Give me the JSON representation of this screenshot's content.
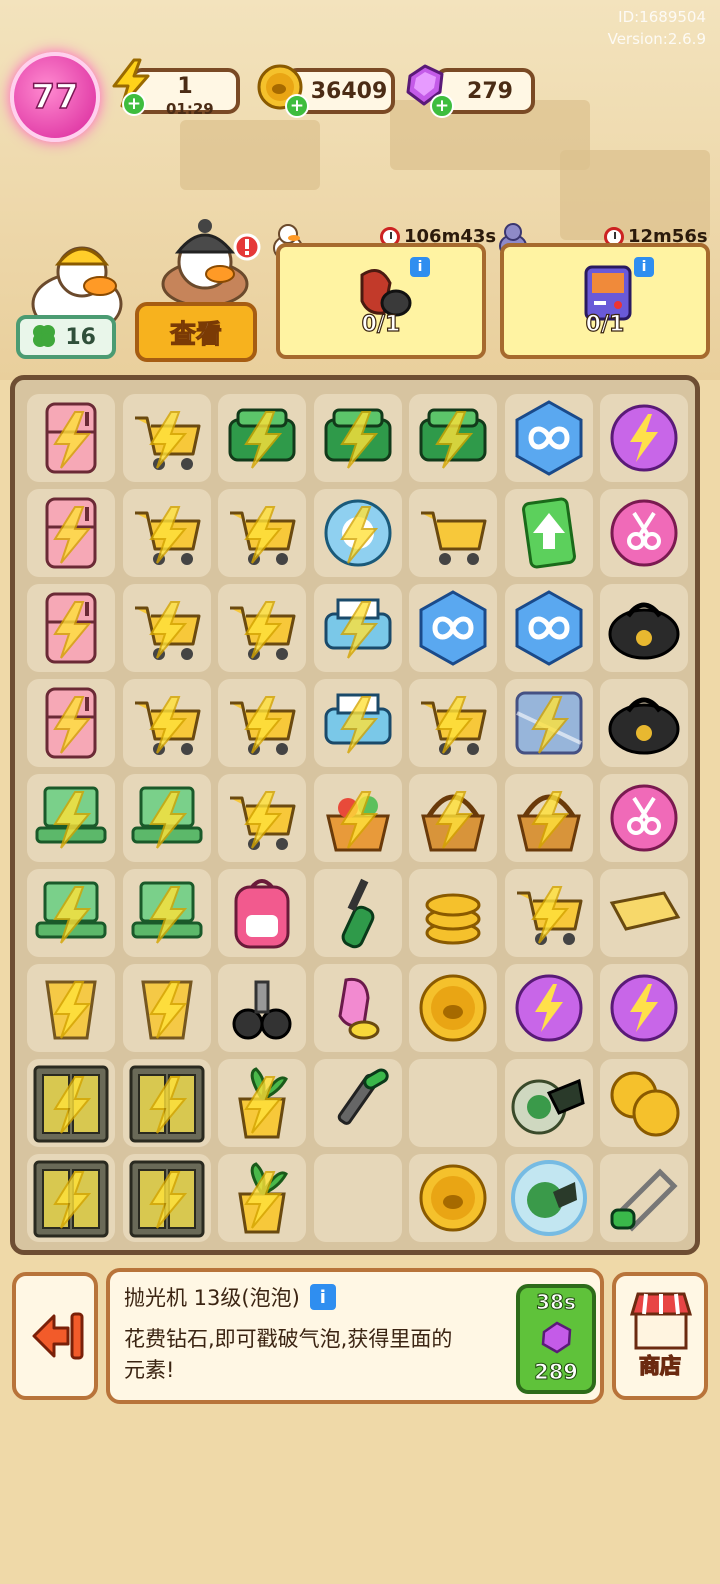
{
  "meta": {
    "id_text": "ID:1689504",
    "version_text": "Version:2.6.9"
  },
  "status": {
    "level": "77",
    "energy": "1",
    "energy_timer": "01:29",
    "coins": "36409",
    "gems": "279"
  },
  "characters": {
    "clover_count": "16",
    "view_button": "查看"
  },
  "orders": [
    {
      "timer": "106m43s",
      "progress": "0/1",
      "item": "chainsaw-icon"
    },
    {
      "timer": "12m56s",
      "progress": "0/1",
      "item": "handheld-console-icon"
    }
  ],
  "board": {
    "cols": 7,
    "rows": 9,
    "cells": [
      [
        "fridge-icon",
        "cart-icon",
        "sewing-machine-icon",
        "sewing-machine-icon",
        "sewing-machine-icon",
        "infinity-hex-icon",
        "lightning-orb-icon"
      ],
      [
        "fridge-icon",
        "cart-icon",
        "cart-icon",
        "robot-vacuum-icon",
        "cart-icon",
        "upgrade-card-icon",
        "scissors-orb-icon"
      ],
      [
        "fridge-icon",
        "cart-icon",
        "cart-icon",
        "printer-icon",
        "infinity-hex-icon",
        "infinity-hex-icon",
        "duffel-bag-icon"
      ],
      [
        "fridge-icon",
        "cart-icon",
        "cart-icon",
        "printer-icon",
        "cart-icon",
        "mystery-box-icon",
        "duffel-bag-icon"
      ],
      [
        "laptop-icon",
        "laptop-icon",
        "cart-icon",
        "gift-basket-icon",
        "basket-icon",
        "basket-icon",
        "scissors-orb-icon"
      ],
      [
        "laptop-icon",
        "laptop-icon",
        "backpack-icon",
        "screwdriver-icon",
        "coin-stack-icon",
        "cart-icon",
        "tray-icon"
      ],
      [
        "cup-icon",
        "cup-icon",
        "caster-wheel-icon",
        "gloves-icon",
        "coin-icon",
        "lightning-orb-icon",
        "lightning-orb-icon"
      ],
      [
        "locker-icon",
        "locker-icon",
        "plant-pot-icon",
        "socket-wrench-icon",
        "empty",
        "polisher-icon",
        "coins-pair-icon"
      ],
      [
        "locker-icon",
        "locker-icon",
        "plant-pot-icon",
        "empty",
        "coin-icon",
        "polisher-bubble-icon",
        "hacksaw-icon"
      ]
    ]
  },
  "selected": {
    "title": "抛光机 13级(泡泡)",
    "description": "花费钻石,即可戳破气泡,获得里面的元素!",
    "pop_timer": "38s",
    "pop_cost": "289"
  },
  "shop_label": "商店",
  "colors": {
    "board_bg": "#d7c4a0",
    "cell_bg": "#e6d7b9",
    "accent_gold": "#f7b21e",
    "gem_purple": "#b14bd6",
    "order_yellow": "#fff3a2"
  }
}
